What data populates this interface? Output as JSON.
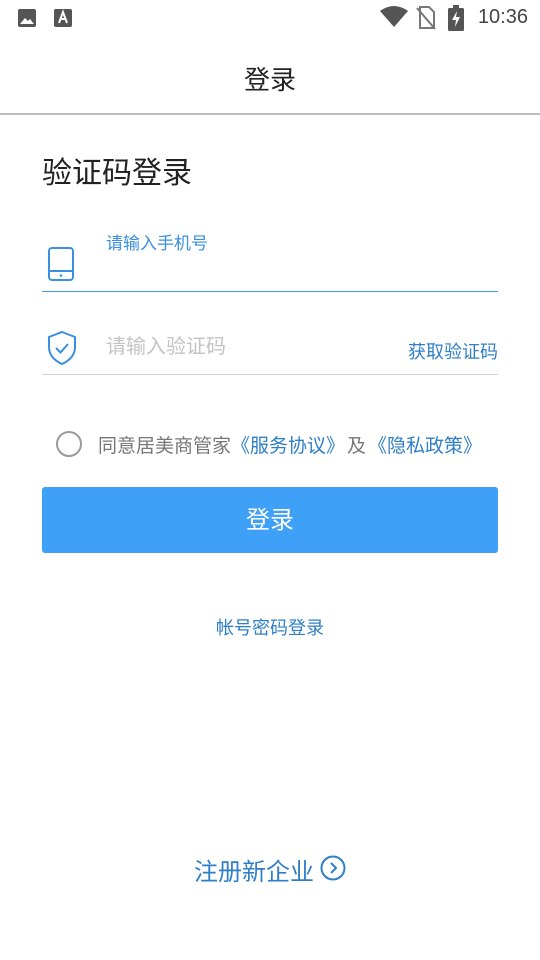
{
  "status_bar": {
    "time": "10:36",
    "icons": [
      "image-icon",
      "text-a-icon",
      "wifi-icon",
      "no-sim-icon",
      "battery-charging-icon"
    ]
  },
  "header": {
    "title": "登录"
  },
  "form": {
    "section_title": "验证码登录",
    "phone": {
      "floating_label": "请输入手机号",
      "icon": "phone-icon"
    },
    "code": {
      "placeholder": "请输入验证码",
      "icon": "shield-check-icon",
      "get_code_label": "获取验证码"
    },
    "agreement": {
      "prefix": "同意居美商管家",
      "service_link": "《服务协议》",
      "conjunction": "及",
      "privacy_link": "《隐私政策》",
      "checked": false
    },
    "login_button": "登录"
  },
  "password_login_link": "帐号密码登录",
  "register_link": "注册新企业",
  "colors": {
    "accent": "#3ea0f7",
    "link": "#2f7fc8"
  }
}
